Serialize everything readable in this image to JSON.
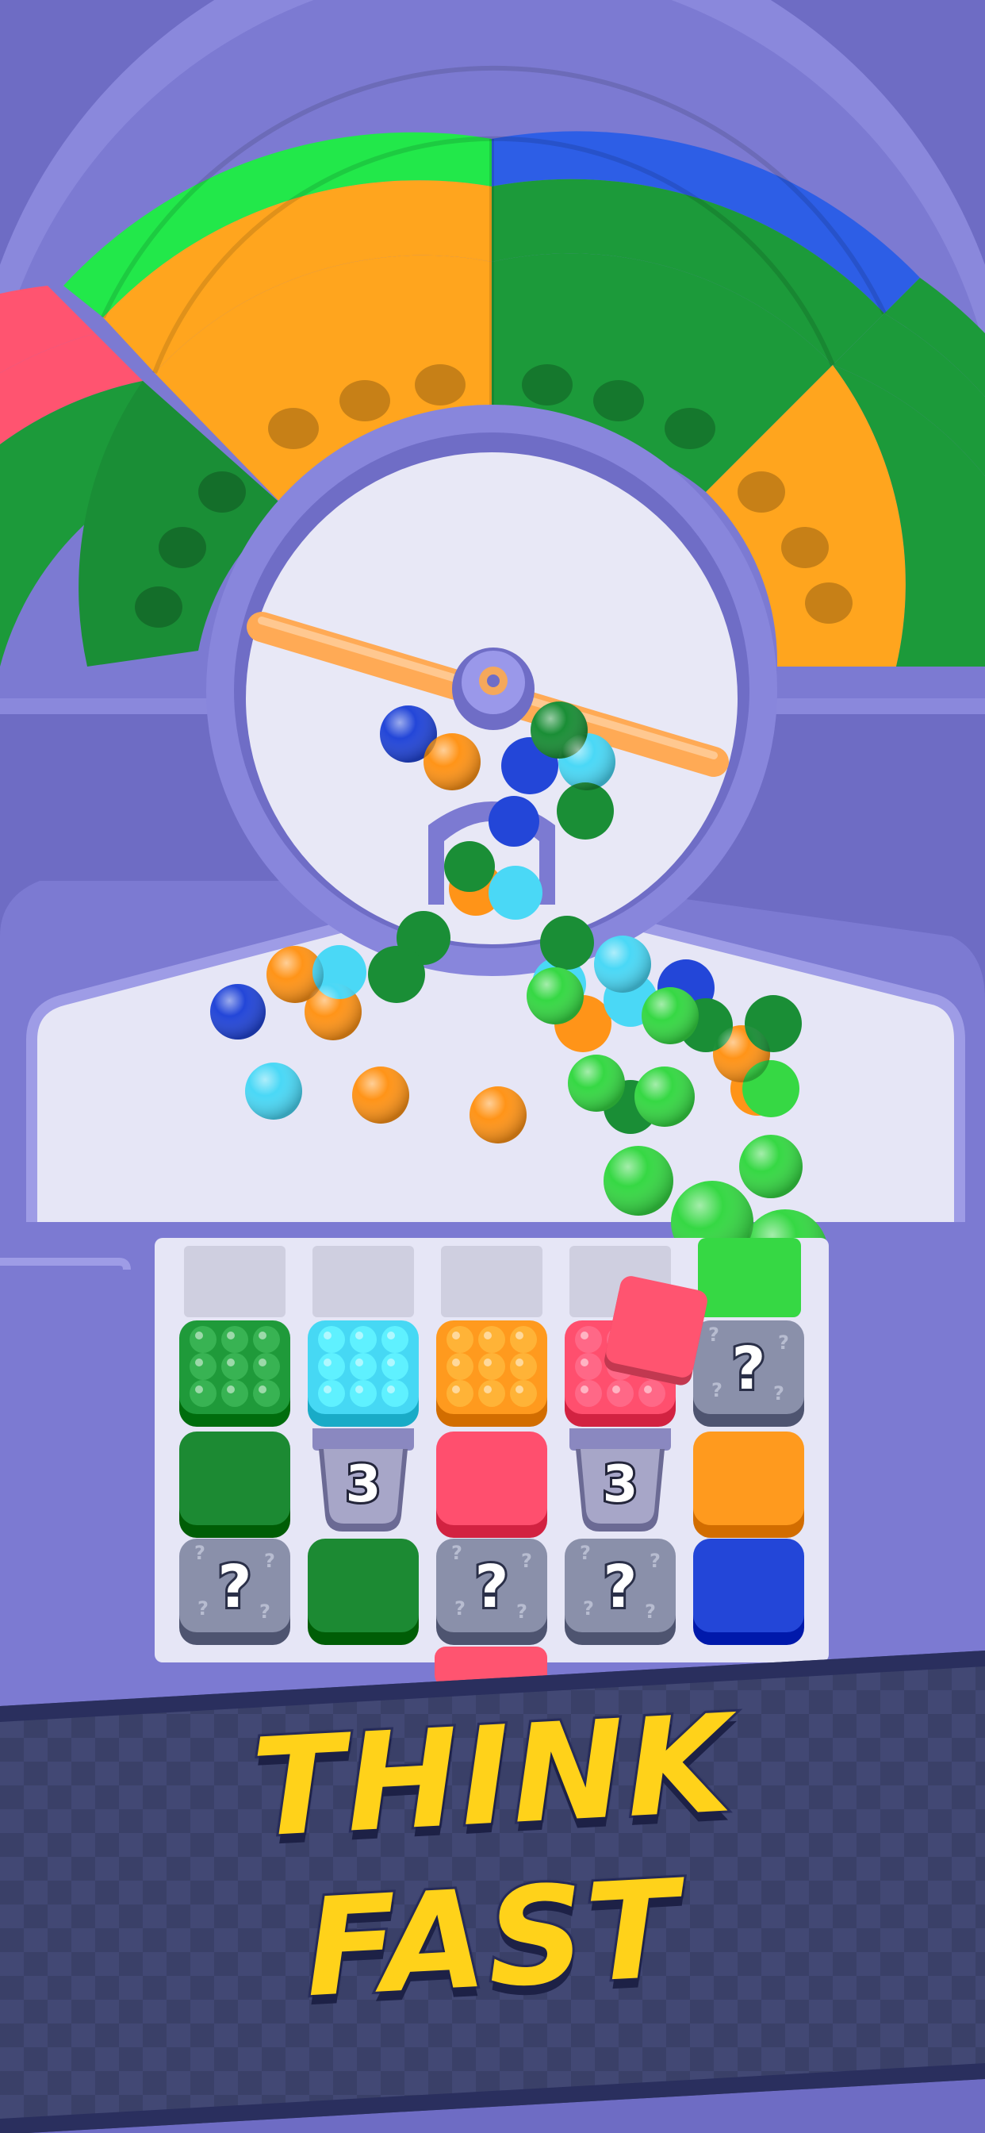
{
  "banner": {
    "line1": "THINK",
    "line2": "FAST"
  },
  "grid": {
    "rows": [
      [
        {
          "kind": "ball-block",
          "color": "#1f9a3a"
        },
        {
          "kind": "ball-block",
          "color": "#46d8f4"
        },
        {
          "kind": "ball-block",
          "color": "#ff9a1e"
        },
        {
          "kind": "ball-block",
          "color": "#ff4f6e"
        },
        {
          "kind": "mystery",
          "label": "?"
        }
      ],
      [
        {
          "kind": "block",
          "color": "#1c8a33"
        },
        {
          "kind": "bucket",
          "label": "3"
        },
        {
          "kind": "block",
          "color": "#ff4f6e"
        },
        {
          "kind": "bucket",
          "label": "3"
        },
        {
          "kind": "block",
          "color": "#ff9a1e"
        }
      ],
      [
        {
          "kind": "mystery",
          "label": "?"
        },
        {
          "kind": "block",
          "color": "#1c8a33"
        },
        {
          "kind": "mystery",
          "label": "?"
        },
        {
          "kind": "mystery",
          "label": "?"
        },
        {
          "kind": "block",
          "color": "#2346d8"
        }
      ]
    ]
  },
  "colors": {
    "background": "#6e6cc4",
    "green": "#1c9a3a",
    "light_green": "#3ad84a",
    "orange": "#ff9a1e",
    "red": "#ff4f6e",
    "blue": "#2346d8",
    "cyan": "#46d8f4",
    "banner_text": "#ffd21a"
  }
}
